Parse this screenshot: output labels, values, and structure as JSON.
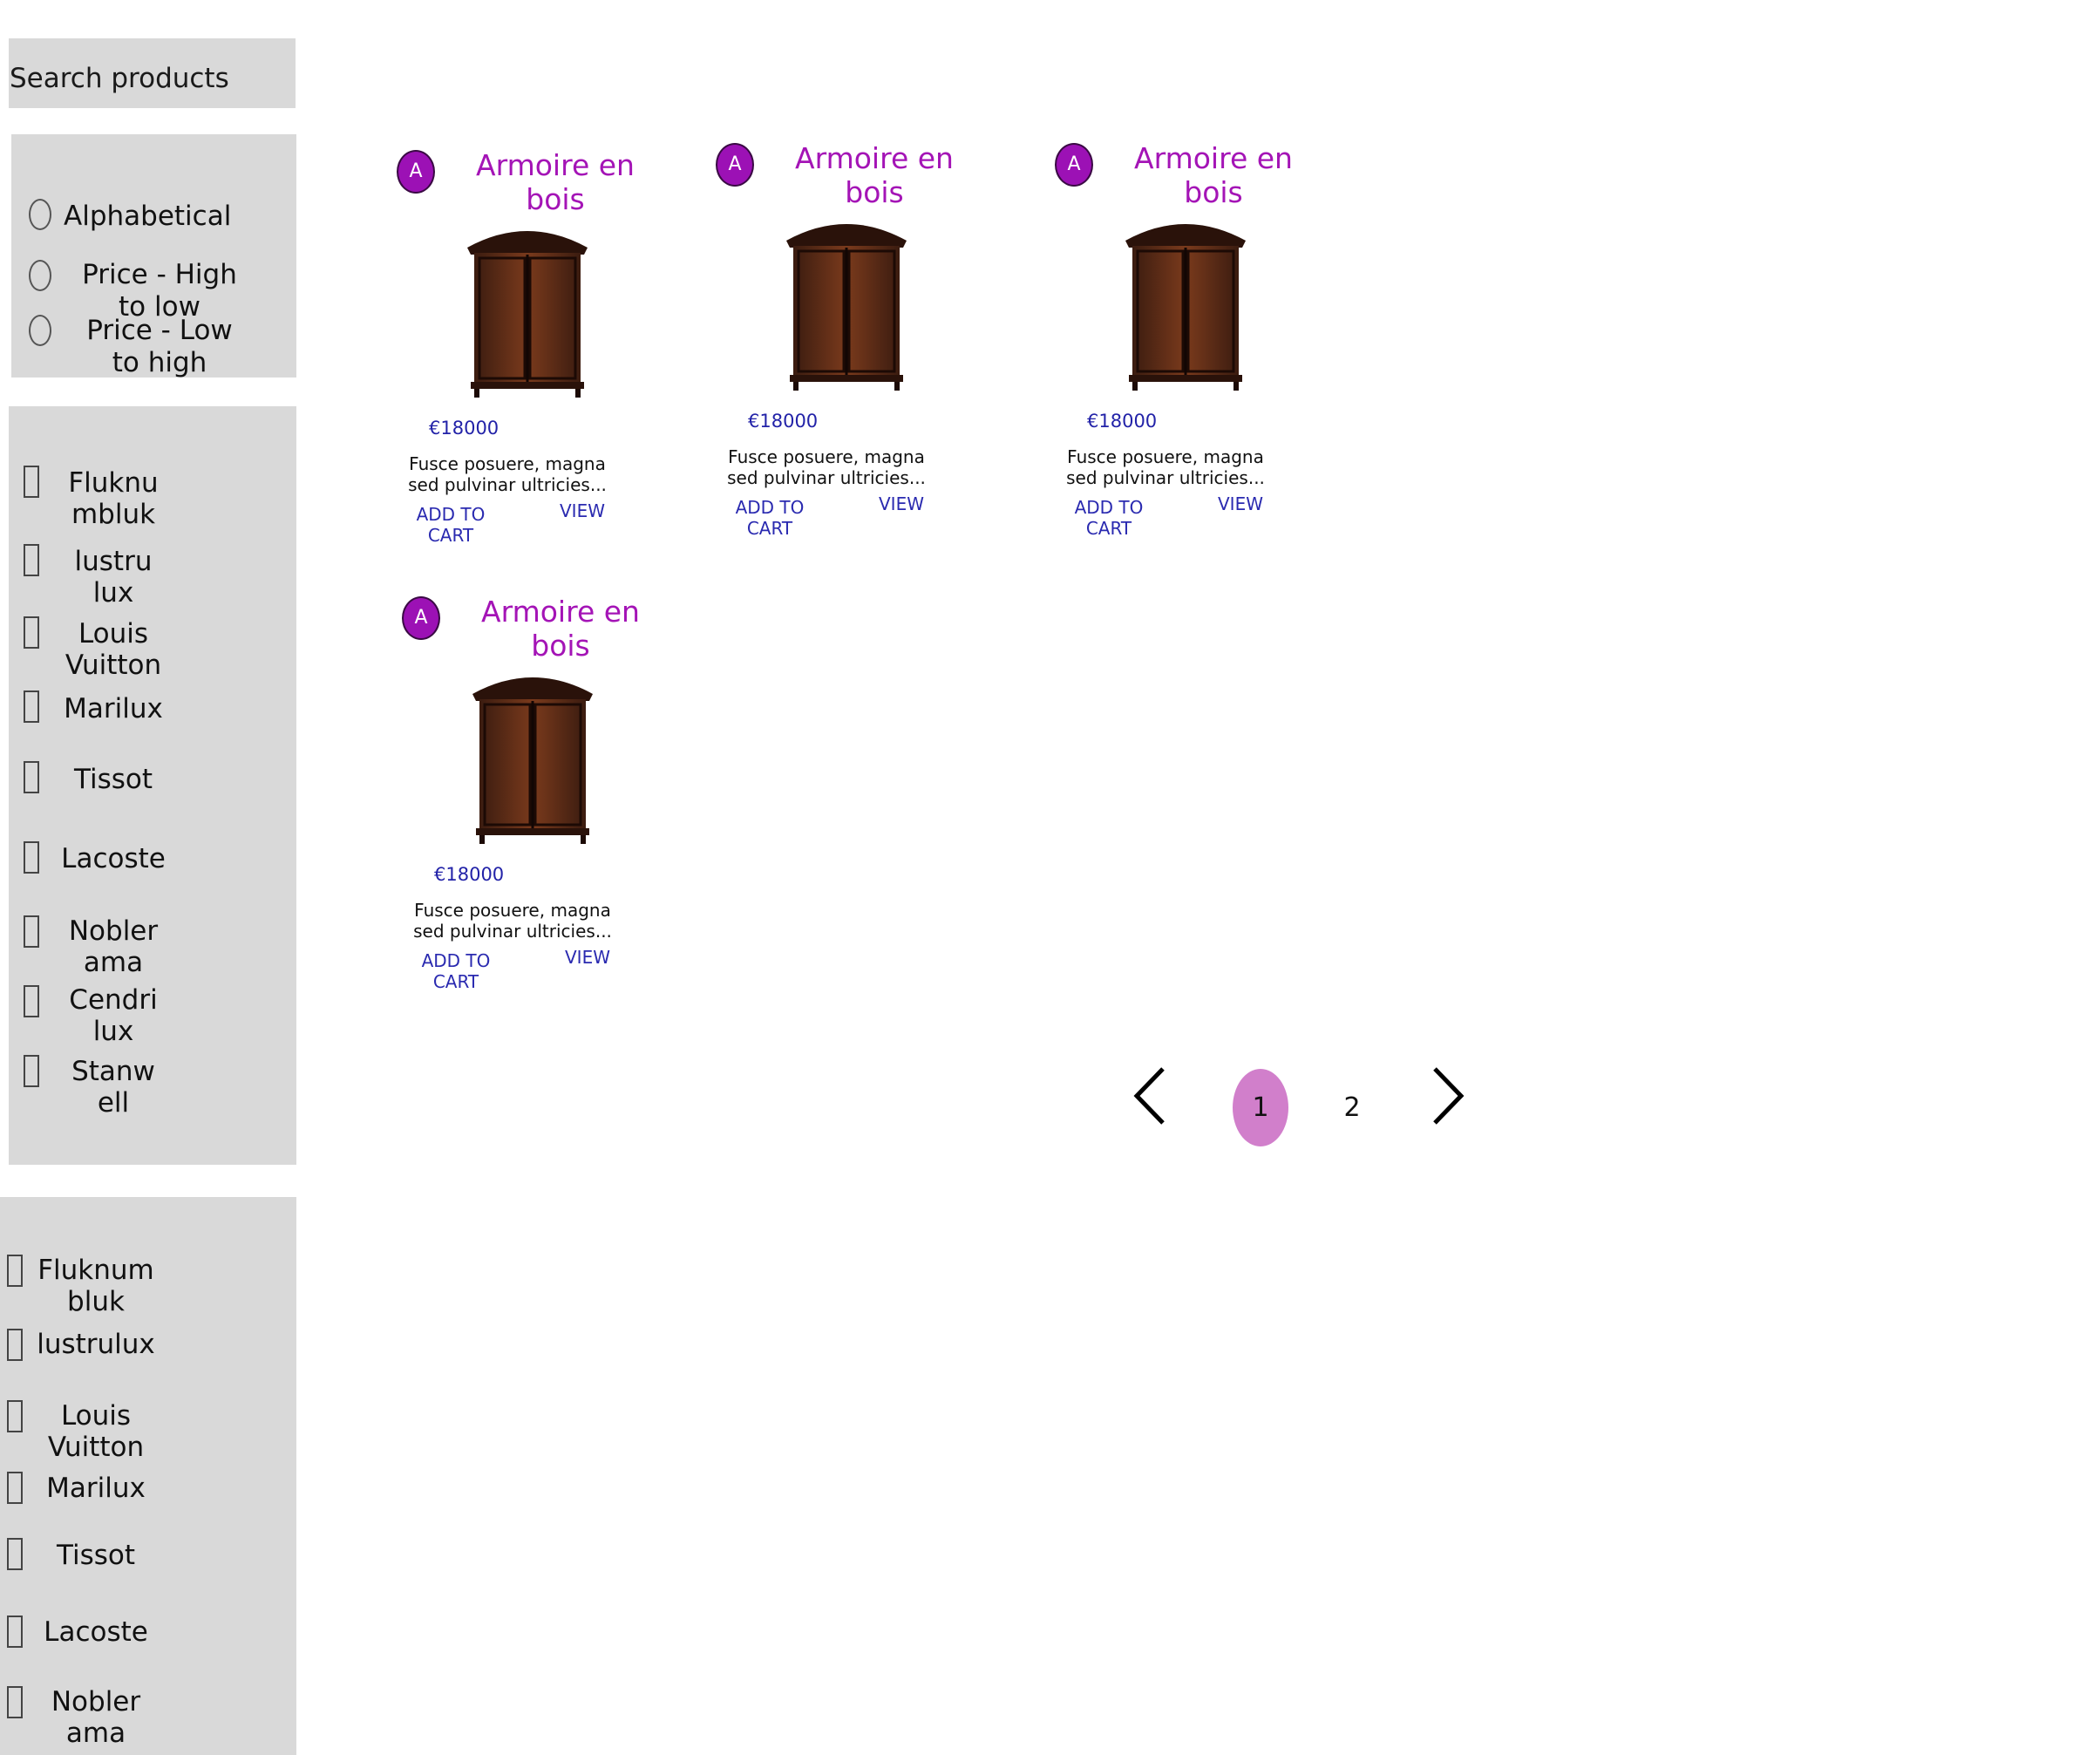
{
  "search": {
    "placeholder": "Search products"
  },
  "sort": {
    "options": [
      {
        "label_lines": [
          "Alphabetical",
          ""
        ]
      },
      {
        "label_lines": [
          "Price - High",
          "to low"
        ]
      },
      {
        "label_lines": [
          "Price - Low",
          "to high"
        ]
      }
    ]
  },
  "brand_filter_1": {
    "items": [
      {
        "lines": [
          "Fluknu",
          "mbluk"
        ]
      },
      {
        "lines": [
          "lustru",
          "lux"
        ]
      },
      {
        "lines": [
          "Louis",
          "Vuitton"
        ]
      },
      {
        "lines": [
          "Marilux",
          ""
        ]
      },
      {
        "lines": [
          "Tissot",
          ""
        ]
      },
      {
        "lines": [
          "Lacoste",
          ""
        ]
      },
      {
        "lines": [
          "Nobler",
          "ama"
        ]
      },
      {
        "lines": [
          "Cendri",
          "lux"
        ]
      },
      {
        "lines": [
          "Stanw",
          "ell"
        ]
      }
    ]
  },
  "brand_filter_2": {
    "items": [
      {
        "lines": [
          "Fluknum",
          "bluk"
        ]
      },
      {
        "lines": [
          "lustrulux",
          ""
        ]
      },
      {
        "lines": [
          "Louis",
          "Vuitton"
        ]
      },
      {
        "lines": [
          "Marilux",
          ""
        ]
      },
      {
        "lines": [
          "Tissot",
          ""
        ]
      },
      {
        "lines": [
          "Lacoste",
          ""
        ]
      },
      {
        "lines": [
          "Nobler",
          "ama"
        ]
      }
    ]
  },
  "products": [
    {
      "avatar_letter": "A",
      "title_lines": [
        "Armoire en",
        "bois"
      ],
      "price": "€18000",
      "desc_lines": [
        "Fusce posuere, magna",
        "sed pulvinar ultricies..."
      ],
      "add_to_cart_lines": [
        "ADD TO",
        "CART"
      ],
      "view": "VIEW"
    },
    {
      "avatar_letter": "A",
      "title_lines": [
        "Armoire en",
        "bois"
      ],
      "price": "€18000",
      "desc_lines": [
        "Fusce posuere, magna",
        "sed pulvinar ultricies..."
      ],
      "add_to_cart_lines": [
        "ADD TO",
        "CART"
      ],
      "view": "VIEW"
    },
    {
      "avatar_letter": "A",
      "title_lines": [
        "Armoire en",
        "bois"
      ],
      "price": "€18000",
      "desc_lines": [
        "Fusce posuere, magna",
        "sed pulvinar ultricies..."
      ],
      "add_to_cart_lines": [
        "ADD TO",
        "CART"
      ],
      "view": "VIEW"
    },
    {
      "avatar_letter": "A",
      "title_lines": [
        "Armoire en",
        "bois"
      ],
      "price": "€18000",
      "desc_lines": [
        "Fusce posuere, magna",
        "sed pulvinar ultricies..."
      ],
      "add_to_cart_lines": [
        "ADD TO",
        "CART"
      ],
      "view": "VIEW"
    }
  ],
  "pagination": {
    "pages": [
      "1",
      "2"
    ],
    "current": "1"
  },
  "colors": {
    "panel_bg": "#d9d9d9",
    "title": "#a414b6",
    "avatar_bg": "#9c11b5",
    "price": "#2222a8",
    "link": "#2a2ab0",
    "active_page": "#d17fcb"
  },
  "icons": {
    "avatar": "letter-avatar-icon",
    "product_image": "wooden-armoire-image",
    "prev": "chevron-left-icon",
    "next": "chevron-right-icon"
  }
}
